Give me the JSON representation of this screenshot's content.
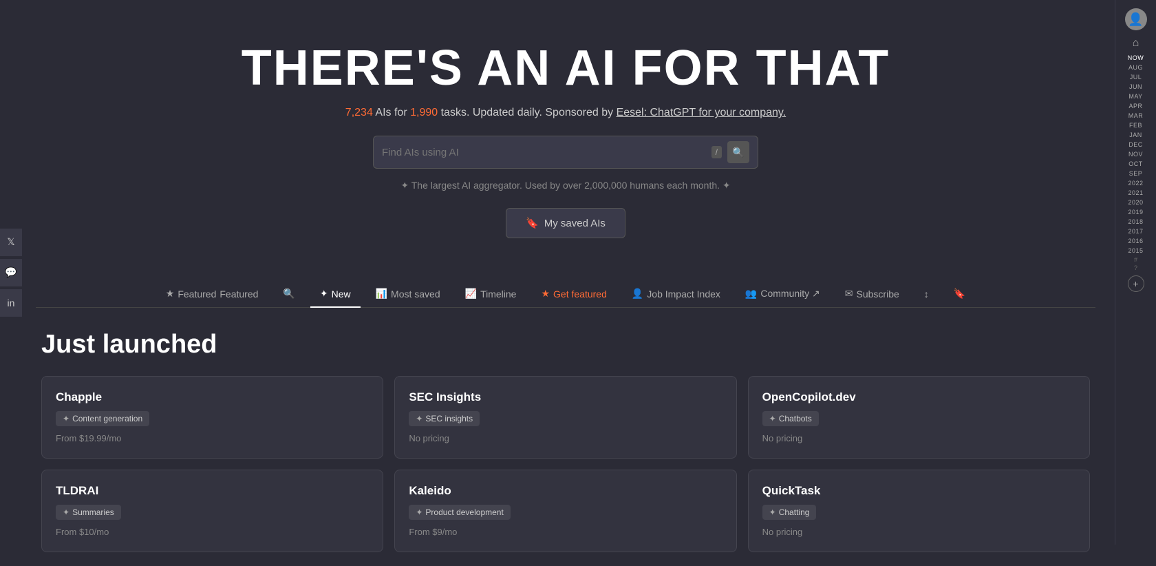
{
  "hero": {
    "title": "THERE'S AN AI FOR THAT",
    "subtitle_count_ai": "7,234",
    "subtitle_text1": " AIs for ",
    "subtitle_count_tasks": "1,990",
    "subtitle_text2": " tasks. Updated daily. Sponsored by ",
    "subtitle_link": "Eesel: ChatGPT for your company.",
    "tagline": "✦ The largest AI aggregator. Used by over 2,000,000 humans each month. ✦"
  },
  "search": {
    "placeholder": "Find AIs using AI",
    "shortcut": "/",
    "icon": "🔍"
  },
  "saved_button": {
    "label": "My saved AIs",
    "icon": "🔖"
  },
  "nav": {
    "tabs": [
      {
        "id": "featured",
        "label": "Featured",
        "icon": "★",
        "active": false
      },
      {
        "id": "search-tab",
        "label": "",
        "icon": "🔍",
        "active": false
      },
      {
        "id": "new",
        "label": "New",
        "icon": "✦",
        "active": true
      },
      {
        "id": "most-saved",
        "label": "Most saved",
        "icon": "📊",
        "active": false
      },
      {
        "id": "timeline",
        "label": "Timeline",
        "icon": "📈",
        "active": false
      },
      {
        "id": "get-featured",
        "label": "Get featured",
        "icon": "★",
        "active": false,
        "featured": true
      },
      {
        "id": "job-impact",
        "label": "Job Impact Index",
        "icon": "👤",
        "active": false
      },
      {
        "id": "community",
        "label": "Community ↗",
        "icon": "👥",
        "active": false
      },
      {
        "id": "subscribe",
        "label": "Subscribe",
        "icon": "✉",
        "active": false
      },
      {
        "id": "sort",
        "label": "",
        "icon": "↕",
        "active": false
      },
      {
        "id": "bookmark",
        "label": "",
        "icon": "🔖",
        "active": false
      }
    ]
  },
  "section": {
    "title": "Just launched"
  },
  "cards": [
    {
      "id": "chapple",
      "title": "Chapple",
      "tag": "Content generation",
      "price": "From $19.99/mo"
    },
    {
      "id": "sec-insights",
      "title": "SEC Insights",
      "tag": "SEC insights",
      "price": "No pricing"
    },
    {
      "id": "opencopilot",
      "title": "OpenCopilot.dev",
      "tag": "Chatbots",
      "price": "No pricing"
    },
    {
      "id": "tldrai",
      "title": "TLDRAI",
      "tag": "Summaries",
      "price": "From $10/mo"
    },
    {
      "id": "kaleido",
      "title": "Kaleido",
      "tag": "Product development",
      "price": "From $9/mo"
    },
    {
      "id": "quicktask",
      "title": "QuickTask",
      "tag": "Chatting",
      "price": "No pricing"
    }
  ],
  "social": [
    {
      "id": "twitter",
      "icon": "𝕏"
    },
    {
      "id": "discord",
      "icon": "💬"
    },
    {
      "id": "linkedin",
      "icon": "in"
    }
  ],
  "timeline": {
    "months_current": [
      "NOW",
      "AUG",
      "JUL",
      "JUN",
      "MAY",
      "APR",
      "MAR",
      "FEB",
      "JAN",
      "DEC",
      "NOV",
      "OCT",
      "SEP"
    ],
    "years": [
      "2022",
      "2021",
      "2020",
      "2019",
      "2018",
      "2017",
      "2016",
      "2015"
    ],
    "special": [
      "#",
      "?"
    ]
  }
}
